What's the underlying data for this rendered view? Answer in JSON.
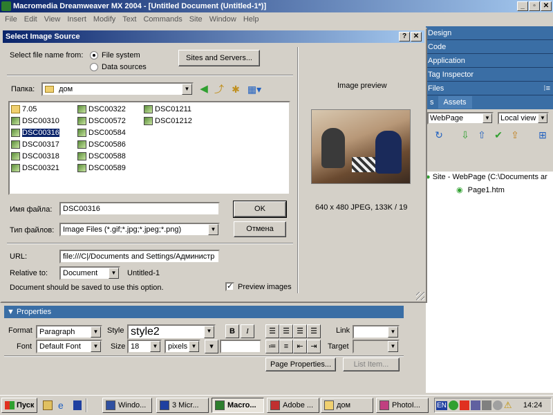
{
  "app": {
    "title": "Macromedia Dreamweaver MX 2004 - [Untitled Document (Untitled-1*)]",
    "window_buttons": [
      "_",
      "▫",
      "✕"
    ]
  },
  "menu": [
    "File",
    "Edit",
    "View",
    "Insert",
    "Modify",
    "Text",
    "Commands",
    "Site",
    "Window",
    "Help"
  ],
  "panels": {
    "design": "Design",
    "code": "Code",
    "application": "Application",
    "tag_inspector": "Tag Inspector",
    "files": "Files",
    "tab_files": "s",
    "tab_assets": "Assets",
    "site_select": "WebPage",
    "view_select": "Local view",
    "tree": [
      "Site - WebPage (C:\\Documents ar",
      "Page1.htm"
    ]
  },
  "dialog": {
    "title": "Select Image Source",
    "help": "?",
    "close": "✕",
    "select_from_label": "Select file name from:",
    "option_file_system": "File system",
    "option_data_sources": "Data sources",
    "sites_servers_button": "Sites and Servers...",
    "folder_label": "Папка:",
    "folder_value": "дом",
    "files": [
      {
        "name": "7.05",
        "type": "folder"
      },
      {
        "name": "DSC00310",
        "type": "image"
      },
      {
        "name": "DSC00316",
        "type": "image",
        "selected": true
      },
      {
        "name": "DSC00317",
        "type": "image"
      },
      {
        "name": "DSC00318",
        "type": "image"
      },
      {
        "name": "DSC00321",
        "type": "image"
      },
      {
        "name": "DSC00322",
        "type": "image"
      },
      {
        "name": "DSC00572",
        "type": "image"
      },
      {
        "name": "DSC00584",
        "type": "image"
      },
      {
        "name": "DSC00586",
        "type": "image"
      },
      {
        "name": "DSC00588",
        "type": "image"
      },
      {
        "name": "DSC00589",
        "type": "image"
      },
      {
        "name": "DSC01211",
        "type": "image"
      },
      {
        "name": "DSC01212",
        "type": "image"
      }
    ],
    "filename_label": "Имя файла:",
    "filename_value": "DSC00316",
    "ok_button": "OK",
    "filetype_label": "Тип файлов:",
    "filetype_value": "Image Files (*.gif;*.jpg;*.jpeg;*.png)",
    "cancel_button": "Отмена",
    "url_label": "URL:",
    "url_value": "file:///C|/Documents and Settings/Администр",
    "relative_label": "Relative to:",
    "relative_value": "Document",
    "relative_doc": "Untitled-1",
    "save_note": "Document should be saved to use this option.",
    "preview_checkbox_label": "Preview images",
    "preview_checked": true,
    "image_preview_label": "Image preview",
    "image_info": "640 x 480 JPEG, 133K / 19"
  },
  "properties": {
    "title": "Properties",
    "format_label": "Format",
    "format_value": "Paragraph",
    "style_label": "Style",
    "style_value": "style2",
    "bold": "B",
    "italic": "I",
    "link_label": "Link",
    "font_label": "Font",
    "font_value": "Default Font",
    "size_label": "Size",
    "size_value": "18",
    "unit_value": "pixels",
    "target_label": "Target",
    "page_properties_button": "Page Properties...",
    "list_item_button": "List Item..."
  },
  "taskbar": {
    "start": "Пуск",
    "tasks": [
      "Windo...",
      "3 Micr...",
      "Macro...",
      "Adobe ...",
      "дом",
      "PhotoI..."
    ],
    "active_task_index": 2,
    "lang": "EN",
    "clock": "14:24"
  }
}
